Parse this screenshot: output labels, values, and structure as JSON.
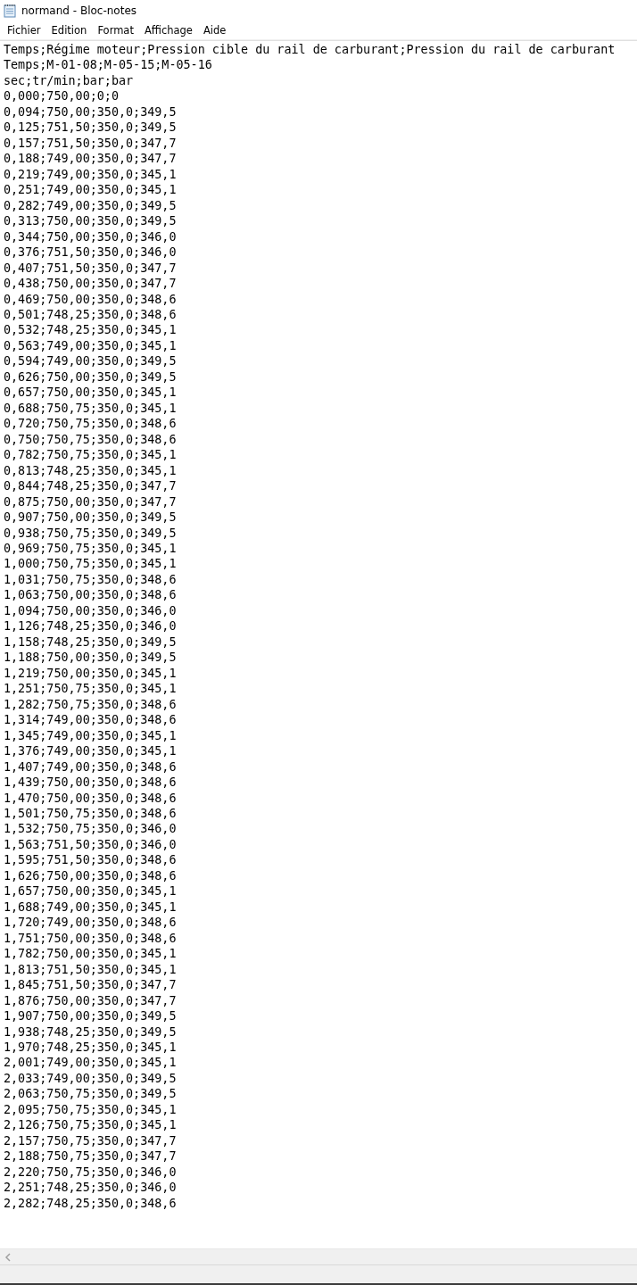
{
  "window": {
    "title": "normand - Bloc-notes"
  },
  "menu": [
    "Fichier",
    "Edition",
    "Format",
    "Affichage",
    "Aide"
  ],
  "document": {
    "lines": [
      "Temps;Régime moteur;Pression cible du rail de carburant;Pression du rail de carburant",
      "Temps;M-01-08;M-05-15;M-05-16",
      "sec;tr/min;bar;bar",
      "0,000;750,00;0;0",
      "0,094;750,00;350,0;349,5",
      "0,125;751,50;350,0;349,5",
      "0,157;751,50;350,0;347,7",
      "0,188;749,00;350,0;347,7",
      "0,219;749,00;350,0;345,1",
      "0,251;749,00;350,0;345,1",
      "0,282;749,00;350,0;349,5",
      "0,313;750,00;350,0;349,5",
      "0,344;750,00;350,0;346,0",
      "0,376;751,50;350,0;346,0",
      "0,407;751,50;350,0;347,7",
      "0,438;750,00;350,0;347,7",
      "0,469;750,00;350,0;348,6",
      "0,501;748,25;350,0;348,6",
      "0,532;748,25;350,0;345,1",
      "0,563;749,00;350,0;345,1",
      "0,594;749,00;350,0;349,5",
      "0,626;750,00;350,0;349,5",
      "0,657;750,00;350,0;345,1",
      "0,688;750,75;350,0;345,1",
      "0,720;750,75;350,0;348,6",
      "0,750;750,75;350,0;348,6",
      "0,782;750,75;350,0;345,1",
      "0,813;748,25;350,0;345,1",
      "0,844;748,25;350,0;347,7",
      "0,875;750,00;350,0;347,7",
      "0,907;750,00;350,0;349,5",
      "0,938;750,75;350,0;349,5",
      "0,969;750,75;350,0;345,1",
      "1,000;750,75;350,0;345,1",
      "1,031;750,75;350,0;348,6",
      "1,063;750,00;350,0;348,6",
      "1,094;750,00;350,0;346,0",
      "1,126;748,25;350,0;346,0",
      "1,158;748,25;350,0;349,5",
      "1,188;750,00;350,0;349,5",
      "1,219;750,00;350,0;345,1",
      "1,251;750,75;350,0;345,1",
      "1,282;750,75;350,0;348,6",
      "1,314;749,00;350,0;348,6",
      "1,345;749,00;350,0;345,1",
      "1,376;749,00;350,0;345,1",
      "1,407;749,00;350,0;348,6",
      "1,439;750,00;350,0;348,6",
      "1,470;750,00;350,0;348,6",
      "1,501;750,75;350,0;348,6",
      "1,532;750,75;350,0;346,0",
      "1,563;751,50;350,0;346,0",
      "1,595;751,50;350,0;348,6",
      "1,626;750,00;350,0;348,6",
      "1,657;750,00;350,0;345,1",
      "1,688;749,00;350,0;345,1",
      "1,720;749,00;350,0;348,6",
      "1,751;750,00;350,0;348,6",
      "1,782;750,00;350,0;345,1",
      "1,813;751,50;350,0;345,1",
      "1,845;751,50;350,0;347,7",
      "1,876;750,00;350,0;347,7",
      "1,907;750,00;350,0;349,5",
      "1,938;748,25;350,0;349,5",
      "1,970;748,25;350,0;345,1",
      "2,001;749,00;350,0;345,1",
      "2,033;749,00;350,0;349,5",
      "2,063;750,75;350,0;349,5",
      "2,095;750,75;350,0;345,1",
      "2,126;750,75;350,0;345,1",
      "2,157;750,75;350,0;347,7",
      "2,188;750,75;350,0;347,7",
      "2,220;750,75;350,0;346,0",
      "2,251;748,25;350,0;346,0",
      "2,282;748,25;350,0;348,6"
    ]
  }
}
